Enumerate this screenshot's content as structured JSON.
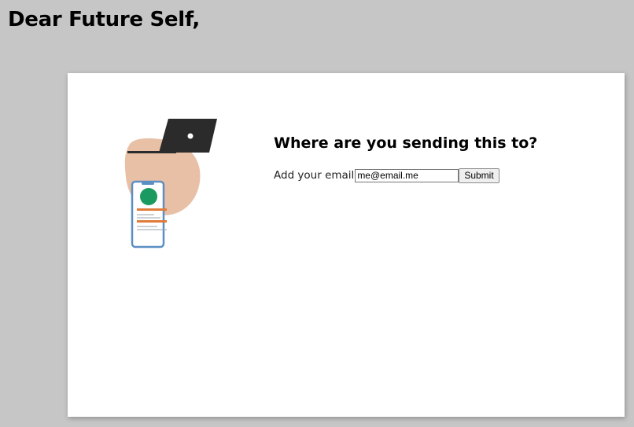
{
  "header": {
    "title": "Dear Future Self,"
  },
  "form": {
    "heading": "Where are you sending this to?",
    "email_label": "Add your email",
    "email_value": "me@email.me",
    "submit_label": "Submit"
  },
  "illustration": {
    "icons": [
      "laptop-icon",
      "smartphone-icon"
    ],
    "colors": {
      "blob": "#e8c0a6",
      "laptop": "#2b2b2b",
      "phone_frame": "#5b8fc4",
      "avatar": "#1a9a61",
      "accent_bar": "#e07b3a"
    }
  }
}
